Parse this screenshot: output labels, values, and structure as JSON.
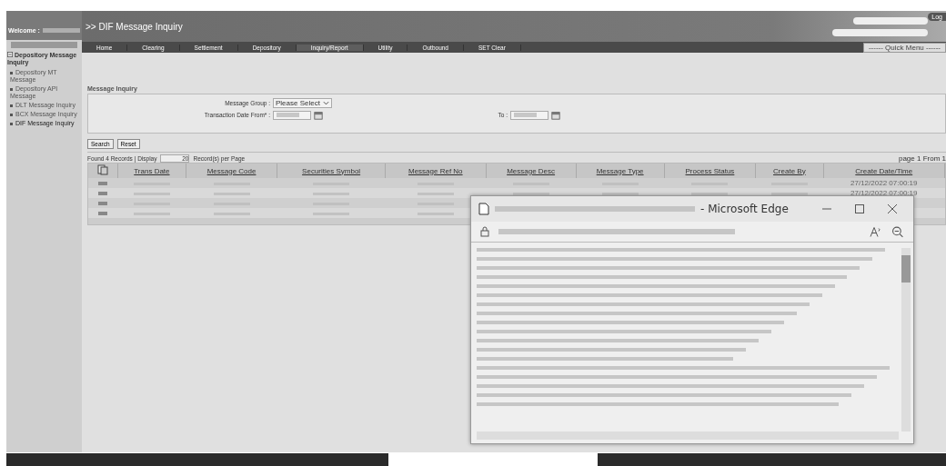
{
  "header": {
    "title": ">> DIF Message Inquiry",
    "logout": "Log"
  },
  "nav": {
    "items": [
      {
        "label": "Home",
        "selected": false
      },
      {
        "label": "Clearing",
        "selected": false
      },
      {
        "label": "Settlement",
        "selected": false
      },
      {
        "label": "Depository",
        "selected": false
      },
      {
        "label": "Inquiry/Report",
        "selected": true
      },
      {
        "label": "Utility",
        "selected": false
      },
      {
        "label": "Outbound",
        "selected": false
      },
      {
        "label": "SET Clear",
        "selected": false
      }
    ],
    "quick_menu": "------ Quick Menu ------"
  },
  "sidebar": {
    "welcome": "Welcome :",
    "tree": [
      {
        "label": "Depository Message Inquiry",
        "expanded": true,
        "children": [
          {
            "label": "Depository MT Message",
            "selected": false
          },
          {
            "label": "Depository API Message",
            "selected": false
          },
          {
            "label": "DLT Message Inquiry",
            "selected": false
          },
          {
            "label": "BCX Message Inquiry",
            "selected": false
          },
          {
            "label": "DIF Message Inquiry",
            "selected": true
          }
        ]
      }
    ]
  },
  "form": {
    "title": "Message Inquiry",
    "group_label": "Message Group :",
    "group_value": "Please Select",
    "from_label": "Transaction Date From* :",
    "to_label": "To :",
    "buttons": [
      "Search",
      "Reset"
    ]
  },
  "results": {
    "found": "Found 4 Records | Display",
    "per_page": "20",
    "per_page_label": "Record(s) per Page",
    "page": "page 1 From 1",
    "columns": [
      "Trans Date",
      "Message Code",
      "Securities Symbol",
      "Message Ref No",
      "Message Desc",
      "Message Type",
      "Process Status",
      "Create By",
      "Create Date/Time"
    ],
    "rows": [
      {
        "create_datetime": "27/12/2022 07:00:19"
      },
      {
        "create_datetime": "27/12/2022 07:00:19"
      },
      {
        "create_datetime": ""
      },
      {
        "create_datetime": ""
      }
    ]
  },
  "popup": {
    "title": "- Microsoft Edge"
  }
}
